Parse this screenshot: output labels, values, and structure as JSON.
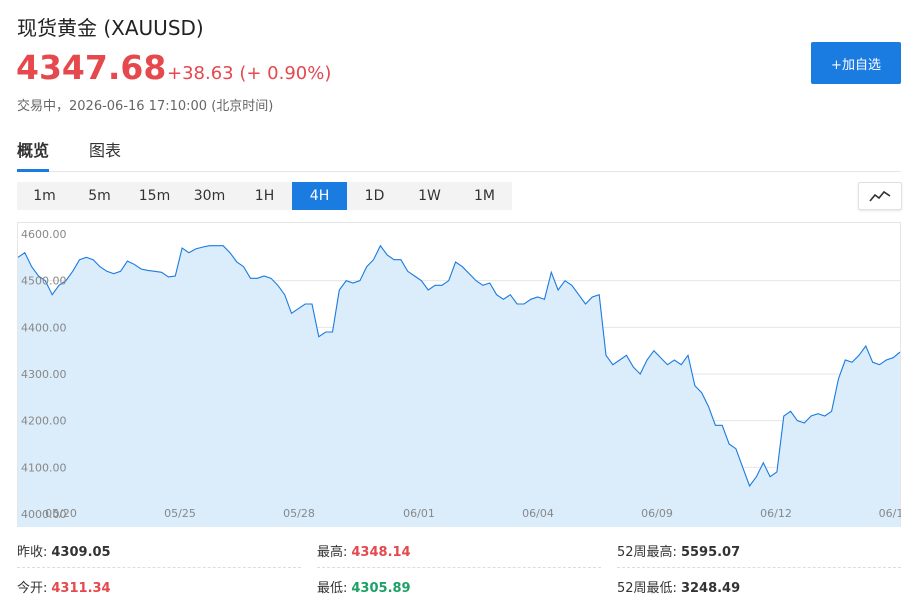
{
  "header": {
    "title": "现货黄金 (XAUUSD)",
    "price": "4347.68",
    "change": "+38.63 (+ 0.90%)",
    "status": "交易中，2026-06-16 17:10:00 (北京时间)",
    "add_button": "+加自选"
  },
  "tabs": [
    {
      "label": "概览",
      "active": true
    },
    {
      "label": "图表",
      "active": false
    }
  ],
  "periods": [
    "1m",
    "5m",
    "15m",
    "30m",
    "1H",
    "4H",
    "1D",
    "1W",
    "1M"
  ],
  "active_period": "4H",
  "chart_type_icon": "line-chart-icon",
  "colors": {
    "accent": "#1a7be0",
    "up": "#e5484d",
    "down": "#1ea067",
    "area": "#dbecfb",
    "line": "#1a7be0"
  },
  "chart_data": {
    "type": "area",
    "ylim": [
      4000,
      4600
    ],
    "y_ticks": [
      "4600.00",
      "4500.00",
      "4400.00",
      "4300.00",
      "4200.00",
      "4100.00",
      "4000.00"
    ],
    "x_ticks": [
      "05/20",
      "05/25",
      "05/28",
      "06/01",
      "06/04",
      "06/09",
      "06/12",
      "06/1"
    ],
    "values": [
      4550,
      4560,
      4530,
      4510,
      4500,
      4470,
      4490,
      4500,
      4520,
      4545,
      4550,
      4545,
      4530,
      4520,
      4515,
      4520,
      4542,
      4535,
      4525,
      4522,
      4520,
      4518,
      4508,
      4510,
      4570,
      4560,
      4568,
      4572,
      4575,
      4575,
      4575,
      4560,
      4540,
      4530,
      4505,
      4505,
      4510,
      4505,
      4490,
      4470,
      4430,
      4440,
      4450,
      4450,
      4380,
      4390,
      4390,
      4480,
      4500,
      4495,
      4500,
      4530,
      4545,
      4575,
      4555,
      4545,
      4545,
      4520,
      4510,
      4500,
      4480,
      4490,
      4490,
      4500,
      4540,
      4530,
      4515,
      4500,
      4490,
      4495,
      4470,
      4460,
      4470,
      4450,
      4450,
      4460,
      4465,
      4460,
      4518,
      4480,
      4500,
      4490,
      4470,
      4450,
      4465,
      4470,
      4340,
      4320,
      4330,
      4340,
      4315,
      4300,
      4330,
      4350,
      4335,
      4320,
      4330,
      4320,
      4340,
      4275,
      4260,
      4230,
      4190,
      4190,
      4150,
      4140,
      4100,
      4060,
      4080,
      4110,
      4080,
      4090,
      4210,
      4220,
      4200,
      4195,
      4210,
      4215,
      4210,
      4220,
      4290,
      4330,
      4325,
      4340,
      4360,
      4325,
      4320,
      4330,
      4335,
      4347
    ]
  },
  "stats": {
    "prev_close_label": "昨收:",
    "prev_close": "4309.05",
    "high_label": "最高:",
    "high": "4348.14",
    "week52_high_label": "52周最高:",
    "week52_high": "5595.07",
    "open_label": "今开:",
    "open": "4311.34",
    "low_label": "最低:",
    "low": "4305.89",
    "week52_low_label": "52周最低:",
    "week52_low": "3248.49"
  }
}
